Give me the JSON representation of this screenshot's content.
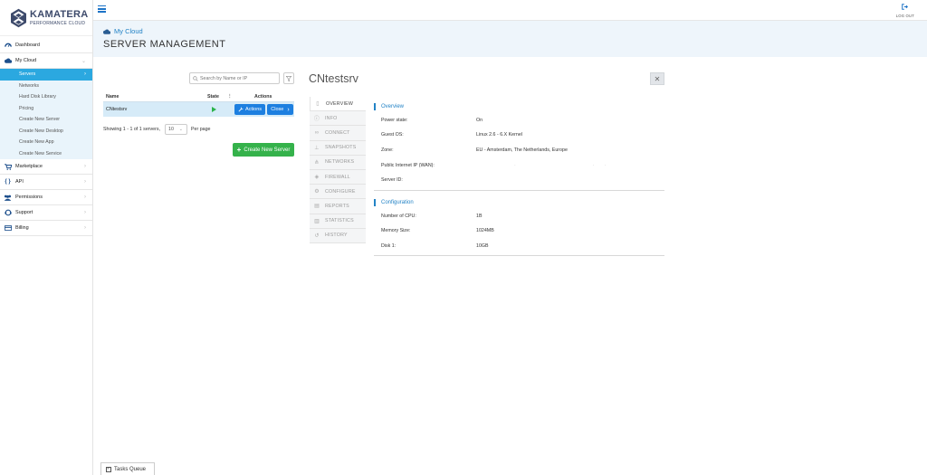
{
  "brand": {
    "name": "KAMATERA",
    "tagline": "PERFORMANCE CLOUD"
  },
  "sidebar": {
    "items": [
      {
        "label": "Dashboard",
        "icon": "dashboard-icon"
      },
      {
        "label": "My Cloud",
        "icon": "cloud-icon"
      },
      {
        "label": "Marketplace",
        "icon": "cart-icon"
      },
      {
        "label": "API",
        "icon": "code-icon"
      },
      {
        "label": "Permissions",
        "icon": "users-icon"
      },
      {
        "label": "Support",
        "icon": "support-icon"
      },
      {
        "label": "Billing",
        "icon": "billing-icon"
      }
    ],
    "my_cloud_sub": [
      {
        "label": "Servers",
        "active": true
      },
      {
        "label": "Networks"
      },
      {
        "label": "Hard Disk Library"
      },
      {
        "label": "Pricing"
      },
      {
        "label": "Create New Server"
      },
      {
        "label": "Create New Desktop"
      },
      {
        "label": "Create New App"
      },
      {
        "label": "Create New Service"
      }
    ]
  },
  "topbar": {
    "logout_label": "LOG OUT"
  },
  "header": {
    "breadcrumb": "My Cloud",
    "title": "SERVER MANAGEMENT"
  },
  "server_list": {
    "search_placeholder": "Search by Name or IP",
    "columns": {
      "name": "Name",
      "state": "State",
      "actions": "Actions"
    },
    "rows": [
      {
        "name": "CNtestsrv",
        "state": "running",
        "actions_label": "Actions",
        "close_label": "Close"
      }
    ],
    "showing": "Showing 1 - 1 of 1 servers,",
    "per_page_value": "10",
    "per_page_label": "Per page",
    "create_button": "Create New Server"
  },
  "detail": {
    "server_name": "CNtestsrv",
    "tabs": [
      {
        "label": "OVERVIEW",
        "icon": "file-icon",
        "active": true
      },
      {
        "label": "INFO",
        "icon": "info-icon"
      },
      {
        "label": "CONNECT",
        "icon": "link-icon"
      },
      {
        "label": "SNAPSHOTS",
        "icon": "pin-icon"
      },
      {
        "label": "NETWORKS",
        "icon": "network-icon"
      },
      {
        "label": "FIREWALL",
        "icon": "shield-icon"
      },
      {
        "label": "CONFIGURE",
        "icon": "configure-icon"
      },
      {
        "label": "REPORTS",
        "icon": "clipboard-icon"
      },
      {
        "label": "STATISTICS",
        "icon": "chart-icon"
      },
      {
        "label": "HISTORY",
        "icon": "history-icon"
      }
    ],
    "overview": {
      "title": "Overview",
      "rows": [
        {
          "label": "Power state:",
          "value": "On"
        },
        {
          "label": "Guest OS:",
          "value": "Linux 2.6 - 6.X Kernel"
        },
        {
          "label": "Zone:",
          "value": "EU - Amsterdam, The Netherlands, Europe"
        },
        {
          "label": "Public Internet IP (WAN):",
          "value": ""
        },
        {
          "label": "Server ID:",
          "value": ""
        }
      ]
    },
    "configuration": {
      "title": "Configuration",
      "rows": [
        {
          "label": "Number of CPU:",
          "value": "1B"
        },
        {
          "label": "Memory Size:",
          "value": "1024MB"
        },
        {
          "label": "Disk 1:",
          "value": "10GB"
        }
      ]
    }
  },
  "tasks_queue": {
    "label": "Tasks Queue"
  },
  "colors": {
    "accent": "#2ba8e0",
    "primary_button": "#1d7fe0",
    "success": "#35b24b",
    "brand": "#3d4a6b"
  }
}
